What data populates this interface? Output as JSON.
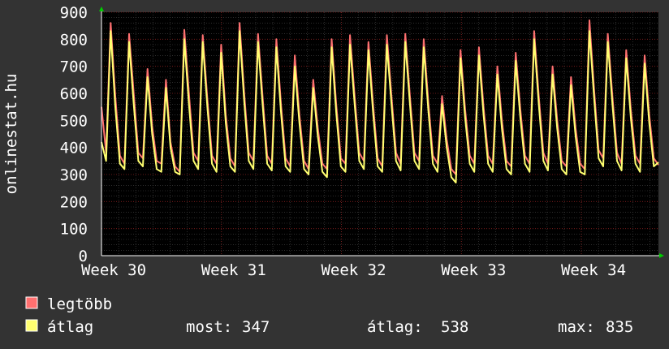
{
  "chart_data": {
    "type": "line",
    "ylabel": "onlinestat.hu",
    "ylim": [
      0,
      900
    ],
    "yticks": [
      0,
      100,
      200,
      300,
      400,
      500,
      600,
      700,
      800,
      900
    ],
    "xticks": [
      "Week 30",
      "Week 31",
      "Week 32",
      "Week 33",
      "Week 34"
    ],
    "x_range_days": [
      0,
      32.5
    ],
    "grid": true,
    "series": [
      {
        "name": "legtöbb",
        "color": "#ff7070",
        "values": [
          550,
          380,
          860,
          590,
          370,
          340,
          820,
          600,
          380,
          360,
          690,
          480,
          350,
          340,
          650,
          420,
          330,
          310,
          835,
          600,
          380,
          350,
          815,
          580,
          370,
          340,
          780,
          520,
          360,
          330,
          860,
          600,
          380,
          350,
          820,
          590,
          370,
          340,
          800,
          560,
          360,
          330,
          740,
          520,
          350,
          320,
          650,
          470,
          340,
          320,
          800,
          560,
          360,
          340,
          815,
          590,
          380,
          350,
          790,
          560,
          360,
          330,
          815,
          590,
          380,
          340,
          820,
          590,
          380,
          350,
          800,
          570,
          370,
          340,
          590,
          430,
          320,
          300,
          760,
          540,
          370,
          340,
          770,
          550,
          370,
          340,
          700,
          500,
          350,
          330,
          750,
          540,
          370,
          340,
          830,
          590,
          380,
          340,
          700,
          500,
          350,
          330,
          660,
          470,
          340,
          320,
          870,
          620,
          390,
          360,
          820,
          590,
          380,
          340,
          760,
          540,
          370,
          340,
          740,
          520,
          360,
          335
        ]
      },
      {
        "name": "átlag",
        "color": "#ffff70",
        "values": [
          420,
          350,
          830,
          550,
          340,
          320,
          790,
          560,
          350,
          330,
          660,
          450,
          320,
          310,
          620,
          400,
          310,
          300,
          800,
          560,
          350,
          320,
          790,
          550,
          340,
          310,
          750,
          490,
          330,
          310,
          830,
          570,
          350,
          320,
          790,
          560,
          340,
          315,
          770,
          530,
          330,
          310,
          700,
          490,
          320,
          300,
          620,
          440,
          310,
          290,
          770,
          530,
          330,
          310,
          780,
          560,
          350,
          320,
          760,
          530,
          330,
          310,
          780,
          560,
          350,
          315,
          790,
          560,
          350,
          320,
          770,
          540,
          340,
          310,
          560,
          400,
          290,
          270,
          730,
          510,
          340,
          310,
          740,
          520,
          340,
          310,
          670,
          470,
          320,
          300,
          720,
          510,
          340,
          310,
          800,
          560,
          350,
          315,
          670,
          470,
          320,
          300,
          630,
          440,
          310,
          300,
          830,
          590,
          360,
          330,
          790,
          560,
          350,
          315,
          730,
          510,
          340,
          310,
          710,
          490,
          330,
          345
        ]
      }
    ],
    "stats": {
      "now_label": "most:",
      "now_value": "347",
      "avg_label": "átlag:",
      "avg_value": "538",
      "max_label": "max:",
      "max_value": "835"
    }
  }
}
